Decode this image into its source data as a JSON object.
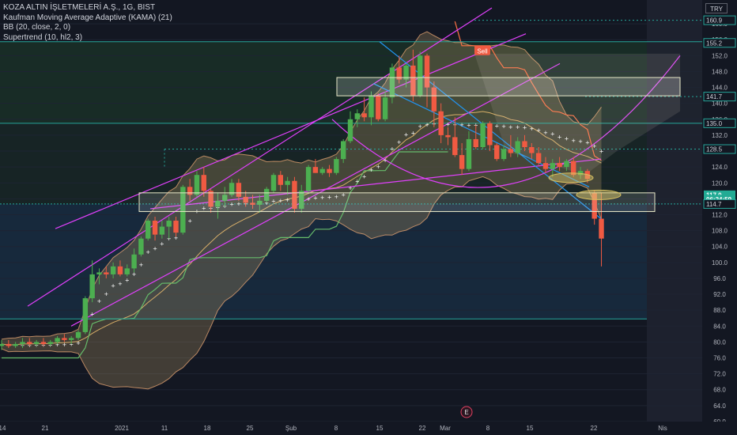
{
  "legend": {
    "symbol": "KOZA ALTIN İŞLETMELERİ A.Ş., 1G, BIST",
    "indicators": [
      "Kaufman Moving Average Adaptive (KAMA) (21)",
      "BB (20, close, 2, 0)",
      "Supertrend (10, hl2, 3)"
    ]
  },
  "currency": "TRY",
  "colors": {
    "background": "#131722",
    "up": "#4caf50",
    "down": "#f05a42",
    "price_tag": "#22ab94",
    "channel": "#e040fb",
    "down_channel": "#2196f3",
    "bb_fill": "#a89060",
    "supertrend_up": "#66bb6a",
    "supertrend_down": "#ff7043",
    "kama": "#ffffff",
    "level_line": "#26a69a"
  },
  "chart_data": {
    "type": "candlestick",
    "x_labels": [
      "14",
      "21",
      "2021",
      "11",
      "18",
      "25",
      "Şub",
      "8",
      "15",
      "22",
      "Mar",
      "8",
      "15",
      "22",
      "Nis"
    ],
    "y_ticks": [
      60.0,
      64.0,
      68.0,
      72.0,
      76.0,
      80.0,
      84.0,
      88.0,
      92.0,
      96.0,
      100.0,
      104.0,
      108.0,
      112.0,
      116.0,
      120.0,
      124.0,
      128.0,
      132.0,
      136.0,
      140.0,
      144.0,
      148.0,
      152.0,
      156.0,
      160.0
    ],
    "ylim": [
      59,
      164
    ],
    "price_labels": [
      {
        "label": "160.9",
        "value": 160.9,
        "style": "outline"
      },
      {
        "label": "155.2",
        "value": 155.2,
        "style": "outline"
      },
      {
        "label": "141.7",
        "value": 141.7,
        "style": "outline"
      },
      {
        "label": "135.0",
        "value": 135.0,
        "style": "outline"
      },
      {
        "label": "128.5",
        "value": 128.5,
        "style": "outline"
      },
      {
        "label": "117.0",
        "value": 117.0,
        "style": "filled"
      },
      {
        "label": "06:24:59",
        "value": 115.9,
        "style": "filled"
      },
      {
        "label": "114.7",
        "value": 114.7,
        "style": "outline"
      }
    ],
    "sell_label": "Sell",
    "event_marker": "E",
    "candles": [
      {
        "o": 79.0,
        "h": 80.5,
        "l": 78.0,
        "c": 79.5
      },
      {
        "o": 79.5,
        "h": 80.5,
        "l": 78.5,
        "c": 79.0
      },
      {
        "o": 79.0,
        "h": 80.0,
        "l": 78.5,
        "c": 79.5
      },
      {
        "o": 79.5,
        "h": 81.0,
        "l": 78.5,
        "c": 80.0
      },
      {
        "o": 80.0,
        "h": 81.0,
        "l": 79.0,
        "c": 79.5
      },
      {
        "o": 79.5,
        "h": 80.5,
        "l": 79.0,
        "c": 80.0
      },
      {
        "o": 80.0,
        "h": 81.0,
        "l": 79.0,
        "c": 79.5
      },
      {
        "o": 79.5,
        "h": 80.5,
        "l": 79.0,
        "c": 80.0
      },
      {
        "o": 80.0,
        "h": 81.5,
        "l": 79.5,
        "c": 81.0
      },
      {
        "o": 81.0,
        "h": 82.0,
        "l": 80.0,
        "c": 80.5
      },
      {
        "o": 80.5,
        "h": 81.5,
        "l": 79.5,
        "c": 81.0
      },
      {
        "o": 81.0,
        "h": 83.0,
        "l": 80.5,
        "c": 82.5
      },
      {
        "o": 82.5,
        "h": 91.5,
        "l": 82.0,
        "c": 91.0
      },
      {
        "o": 91.0,
        "h": 100.5,
        "l": 90.0,
        "c": 97.0
      },
      {
        "o": 97.0,
        "h": 98.5,
        "l": 94.5,
        "c": 97.5
      },
      {
        "o": 97.5,
        "h": 99.0,
        "l": 96.0,
        "c": 97.0
      },
      {
        "o": 97.0,
        "h": 100.0,
        "l": 96.0,
        "c": 99.0
      },
      {
        "o": 99.0,
        "h": 100.5,
        "l": 96.5,
        "c": 97.0
      },
      {
        "o": 97.0,
        "h": 99.5,
        "l": 96.5,
        "c": 98.5
      },
      {
        "o": 98.5,
        "h": 103.5,
        "l": 97.5,
        "c": 102.0
      },
      {
        "o": 102.0,
        "h": 106.5,
        "l": 101.5,
        "c": 106.0
      },
      {
        "o": 106.0,
        "h": 111.0,
        "l": 105.5,
        "c": 110.5
      },
      {
        "o": 110.5,
        "h": 111.5,
        "l": 105.5,
        "c": 107.0
      },
      {
        "o": 107.0,
        "h": 110.5,
        "l": 106.0,
        "c": 109.0
      },
      {
        "o": 109.0,
        "h": 111.5,
        "l": 106.0,
        "c": 110.5
      },
      {
        "o": 110.5,
        "h": 111.5,
        "l": 106.5,
        "c": 107.5
      },
      {
        "o": 107.5,
        "h": 119.5,
        "l": 107.0,
        "c": 119.0
      },
      {
        "o": 119.0,
        "h": 121.0,
        "l": 115.5,
        "c": 117.0
      },
      {
        "o": 117.0,
        "h": 123.0,
        "l": 116.5,
        "c": 122.0
      },
      {
        "o": 122.0,
        "h": 124.0,
        "l": 116.5,
        "c": 118.0
      },
      {
        "o": 118.0,
        "h": 118.5,
        "l": 112.5,
        "c": 114.0
      },
      {
        "o": 114.0,
        "h": 117.5,
        "l": 111.0,
        "c": 115.5
      },
      {
        "o": 115.5,
        "h": 119.0,
        "l": 114.0,
        "c": 117.0
      },
      {
        "o": 117.0,
        "h": 121.0,
        "l": 116.5,
        "c": 120.0
      },
      {
        "o": 120.0,
        "h": 121.0,
        "l": 115.5,
        "c": 116.5
      },
      {
        "o": 116.5,
        "h": 118.0,
        "l": 114.0,
        "c": 115.0
      },
      {
        "o": 115.0,
        "h": 117.0,
        "l": 113.5,
        "c": 114.5
      },
      {
        "o": 114.5,
        "h": 117.0,
        "l": 112.5,
        "c": 115.5
      },
      {
        "o": 115.5,
        "h": 119.0,
        "l": 115.0,
        "c": 118.5
      },
      {
        "o": 118.0,
        "h": 122.5,
        "l": 117.5,
        "c": 122.0
      },
      {
        "o": 122.0,
        "h": 123.0,
        "l": 118.0,
        "c": 119.5
      },
      {
        "o": 119.5,
        "h": 121.5,
        "l": 117.0,
        "c": 120.5
      },
      {
        "o": 120.5,
        "h": 121.5,
        "l": 112.5,
        "c": 113.5
      },
      {
        "o": 113.5,
        "h": 119.5,
        "l": 112.5,
        "c": 118.0
      },
      {
        "o": 118.0,
        "h": 124.5,
        "l": 117.5,
        "c": 124.0
      },
      {
        "o": 124.0,
        "h": 126.0,
        "l": 122.5,
        "c": 122.5
      },
      {
        "o": 122.5,
        "h": 124.0,
        "l": 122.0,
        "c": 123.5
      },
      {
        "o": 123.5,
        "h": 124.5,
        "l": 121.5,
        "c": 122.5
      },
      {
        "o": 122.5,
        "h": 126.5,
        "l": 122.0,
        "c": 126.0
      },
      {
        "o": 126.0,
        "h": 131.0,
        "l": 125.0,
        "c": 130.5
      },
      {
        "o": 130.5,
        "h": 138.0,
        "l": 130.0,
        "c": 136.0
      },
      {
        "o": 136.0,
        "h": 138.5,
        "l": 134.0,
        "c": 137.5
      },
      {
        "o": 137.5,
        "h": 141.5,
        "l": 135.5,
        "c": 136.5
      },
      {
        "o": 136.5,
        "h": 143.0,
        "l": 134.5,
        "c": 142.0
      },
      {
        "o": 142.0,
        "h": 142.5,
        "l": 135.5,
        "c": 136.0
      },
      {
        "o": 136.0,
        "h": 143.0,
        "l": 135.5,
        "c": 141.5
      },
      {
        "o": 141.5,
        "h": 150.0,
        "l": 140.0,
        "c": 149.0
      },
      {
        "o": 149.0,
        "h": 152.0,
        "l": 145.0,
        "c": 146.0
      },
      {
        "o": 146.0,
        "h": 150.0,
        "l": 144.0,
        "c": 149.5
      },
      {
        "o": 149.5,
        "h": 153.5,
        "l": 140.5,
        "c": 142.0
      },
      {
        "o": 142.0,
        "h": 153.0,
        "l": 141.5,
        "c": 152.0
      },
      {
        "o": 152.0,
        "h": 152.5,
        "l": 139.0,
        "c": 144.0
      },
      {
        "o": 144.0,
        "h": 145.5,
        "l": 134.0,
        "c": 138.0
      },
      {
        "o": 138.0,
        "h": 140.0,
        "l": 130.0,
        "c": 132.0
      },
      {
        "o": 132.0,
        "h": 134.0,
        "l": 129.5,
        "c": 131.5
      },
      {
        "o": 131.5,
        "h": 136.5,
        "l": 126.5,
        "c": 127.0
      },
      {
        "o": 127.0,
        "h": 130.0,
        "l": 122.0,
        "c": 123.5
      },
      {
        "o": 123.5,
        "h": 133.0,
        "l": 123.0,
        "c": 131.0
      },
      {
        "o": 131.0,
        "h": 134.5,
        "l": 128.5,
        "c": 129.0
      },
      {
        "o": 129.0,
        "h": 135.5,
        "l": 128.5,
        "c": 135.0
      },
      {
        "o": 135.0,
        "h": 135.5,
        "l": 128.0,
        "c": 129.5
      },
      {
        "o": 129.5,
        "h": 130.0,
        "l": 125.5,
        "c": 126.0
      },
      {
        "o": 126.0,
        "h": 129.5,
        "l": 125.5,
        "c": 128.5
      },
      {
        "o": 128.5,
        "h": 132.0,
        "l": 126.5,
        "c": 127.5
      },
      {
        "o": 127.5,
        "h": 131.5,
        "l": 126.5,
        "c": 130.5
      },
      {
        "o": 130.5,
        "h": 132.0,
        "l": 128.0,
        "c": 129.0
      },
      {
        "o": 129.0,
        "h": 130.0,
        "l": 126.0,
        "c": 127.5
      },
      {
        "o": 127.5,
        "h": 129.0,
        "l": 124.5,
        "c": 125.0
      },
      {
        "o": 125.0,
        "h": 126.5,
        "l": 122.5,
        "c": 123.5
      },
      {
        "o": 123.5,
        "h": 126.0,
        "l": 121.5,
        "c": 125.0
      },
      {
        "o": 125.0,
        "h": 126.5,
        "l": 123.0,
        "c": 124.0
      },
      {
        "o": 124.0,
        "h": 126.0,
        "l": 123.0,
        "c": 125.5
      },
      {
        "o": 125.5,
        "h": 126.5,
        "l": 121.5,
        "c": 122.0
      },
      {
        "o": 122.0,
        "h": 124.0,
        "l": 121.0,
        "c": 123.0
      },
      {
        "o": 123.0,
        "h": 123.5,
        "l": 120.0,
        "c": 121.0
      },
      {
        "o": 117.5,
        "h": 118.0,
        "l": 109.5,
        "c": 111.0
      },
      {
        "o": 111.0,
        "h": 117.5,
        "l": 99.0,
        "c": 106.0
      }
    ]
  }
}
